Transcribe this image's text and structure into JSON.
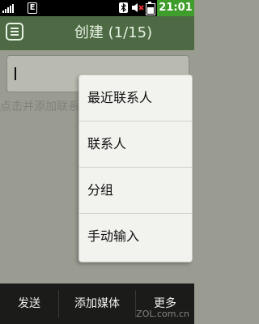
{
  "status_bar": {
    "network_type": "E",
    "time": "21:01",
    "icons": [
      "signal-icon",
      "network-e-icon",
      "bluetooth-icon",
      "mute-icon",
      "battery-icon"
    ]
  },
  "header": {
    "title": "创建 (1/15)",
    "menu_icon": "list-menu-icon"
  },
  "compose": {
    "recipient_value": "",
    "add_hint": "点击并添加联系人"
  },
  "popup_menu": {
    "items": [
      "最近联系人",
      "联系人",
      "分组",
      "手动输入"
    ]
  },
  "bottom_bar": {
    "send_label": "发送",
    "add_media_label": "添加媒体",
    "more_label": "更多"
  },
  "watermark": "ZOL.com.cn",
  "colors": {
    "header_bg": "#4d6a44",
    "time_bg": "#3f9d2b",
    "page_bg": "#9a9c92",
    "popup_bg": "#f2f2ee",
    "bottom_bar_bg": "#1b1b19"
  }
}
